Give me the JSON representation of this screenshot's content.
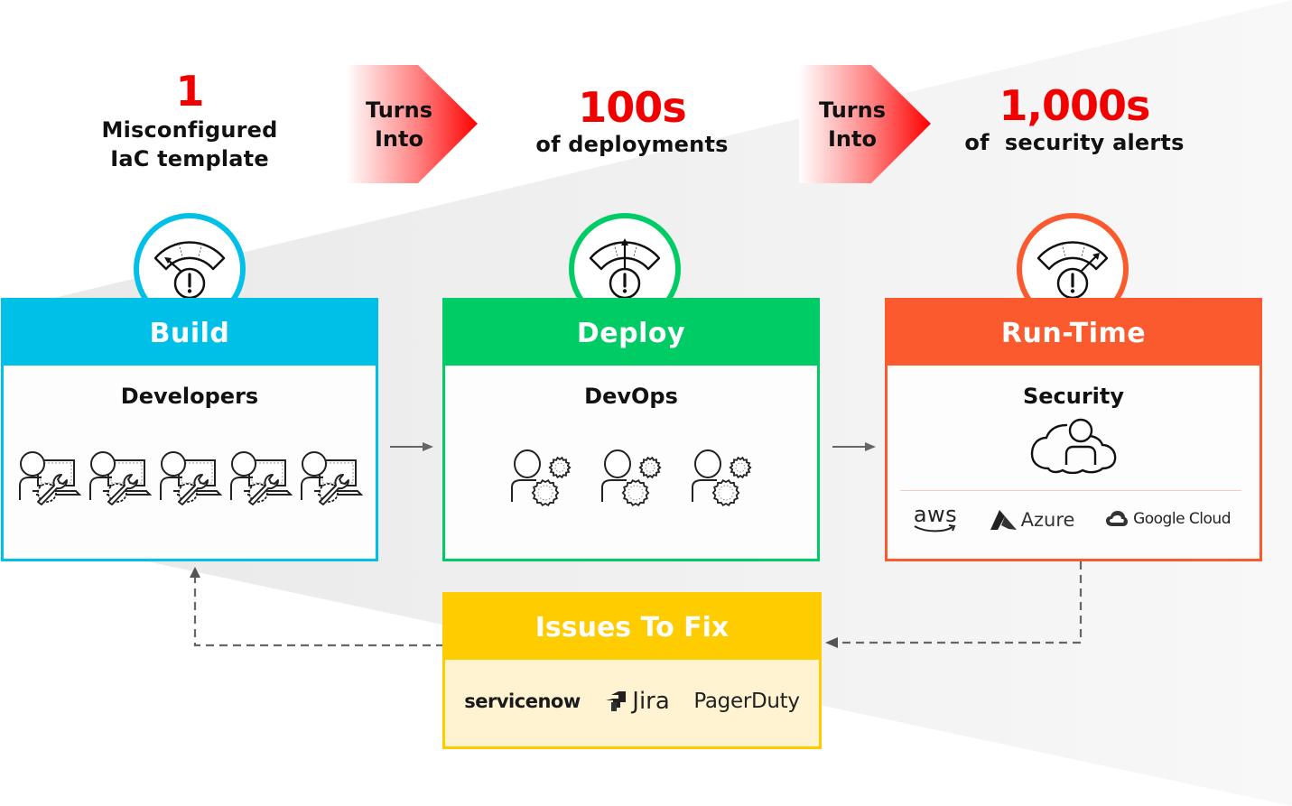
{
  "headlines": [
    {
      "figure": "1",
      "caption_lines": [
        "Misconfigured",
        "IaC template"
      ]
    },
    {
      "figure": "100s",
      "caption_lines": [
        "of deployments"
      ]
    },
    {
      "figure": "1,000s",
      "caption_lines": [
        "of  security alerts"
      ]
    }
  ],
  "connectors": [
    {
      "lines": [
        "Turns",
        "Into"
      ]
    },
    {
      "lines": [
        "Turns",
        "Into"
      ]
    }
  ],
  "stages": [
    {
      "title": "Build",
      "role": "Developers",
      "color": "#00c0e8",
      "people_icon": "developer-wrench-laptop-icon",
      "people_count": 5,
      "gauge_level": "low"
    },
    {
      "title": "Deploy",
      "role": "DevOps",
      "color": "#00cc66",
      "people_icon": "devops-person-gears-icon",
      "people_count": 3,
      "gauge_level": "medium"
    },
    {
      "title": "Run-Time",
      "role": "Security",
      "color": "#fa5a2e",
      "people_icon": "cloud-person-icon",
      "people_count": 1,
      "gauge_level": "high",
      "clouds": [
        "aws",
        "Azure",
        "Google Cloud"
      ]
    }
  ],
  "issues": {
    "title": "Issues To Fix",
    "color": "#ffcc00",
    "tools": [
      "servicenow",
      "Jira",
      "PagerDuty"
    ]
  },
  "colors": {
    "accent_red": "#f20000",
    "arrow_gray": "#666666",
    "wedge_gray": "#efefef"
  }
}
